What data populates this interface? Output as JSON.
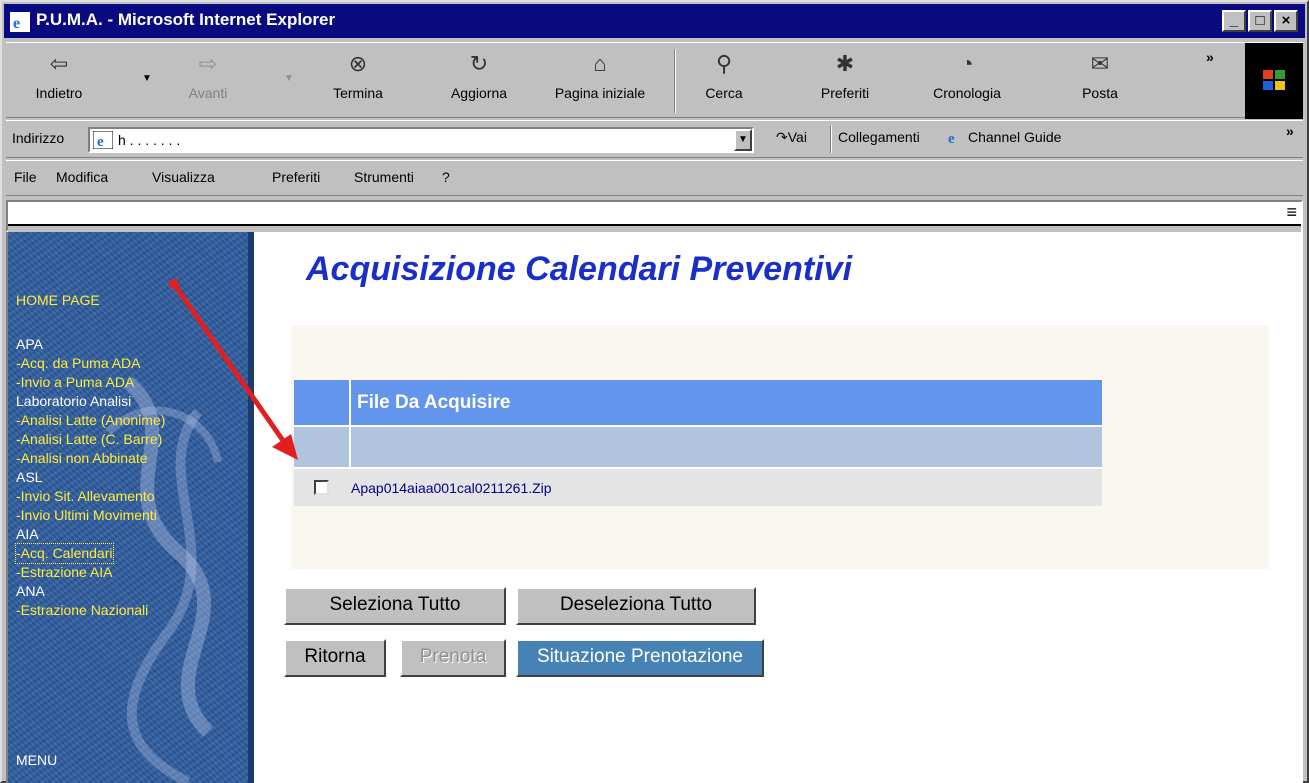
{
  "window": {
    "title": "P.U.M.A. - Microsoft Internet Explorer",
    "min": "_",
    "max": "□",
    "close": "×"
  },
  "toolbar": {
    "back": "Indietro",
    "forward": "Avanti",
    "stop": "Termina",
    "refresh": "Aggiorna",
    "home": "Pagina iniziale",
    "search": "Cerca",
    "favorites": "Preferiti",
    "history": "Cronologia",
    "mail": "Posta",
    "more": "»"
  },
  "addressbar": {
    "label": "Indirizzo",
    "value": "h   .  .  .  .  .  .  .",
    "go": "Vai",
    "links": "Collegamenti",
    "channel_guide": "Channel Guide",
    "more": "»"
  },
  "menu": {
    "file": "File",
    "edit": "Modifica",
    "view": "Visualizza",
    "favorites": "Preferiti",
    "tools": "Strumenti",
    "help": "?"
  },
  "sidebar": {
    "home": "HOME PAGE",
    "items": [
      {
        "label": "APA",
        "type": "head"
      },
      {
        "label": "-Acq. da Puma ADA",
        "type": "link"
      },
      {
        "label": "-Invio a Puma ADA",
        "type": "link"
      },
      {
        "label": "Laboratorio Analisi",
        "type": "head"
      },
      {
        "label": "-Analisi Latte (Anonime)",
        "type": "link"
      },
      {
        "label": "-Analisi Latte (C. Barre)",
        "type": "link"
      },
      {
        "label": "-Analisi non Abbinate",
        "type": "link"
      },
      {
        "label": "ASL",
        "type": "head"
      },
      {
        "label": "-Invio Sit. Allevamento",
        "type": "link"
      },
      {
        "label": "-Invio Ultimi Movimenti",
        "type": "link"
      },
      {
        "label": "AIA",
        "type": "head"
      },
      {
        "label": "-Acq. Calendari",
        "type": "link",
        "active": true
      },
      {
        "label": "-Estrazione AIA",
        "type": "link"
      },
      {
        "label": "ANA",
        "type": "head"
      },
      {
        "label": "-Estrazione Nazionali",
        "type": "link"
      }
    ],
    "menu": "MENU"
  },
  "main": {
    "title": "Acquisizione Calendari Preventivi",
    "table": {
      "header": "File Da Acquisire",
      "rows": [
        {
          "checked": false,
          "name": "Apap014aiaa001cal0211261.Zip"
        }
      ]
    },
    "buttons": {
      "select_all": "Seleziona Tutto",
      "deselect_all": "Deseleziona Tutto",
      "back": "Ritorna",
      "book": "Prenota",
      "status": "Situazione Prenotazione"
    }
  },
  "colors": {
    "title_bar": "#0a0a80",
    "sidebar": "#2f5ea0",
    "link": "#ffeb3b",
    "page_title": "#1a2ec8",
    "table_header": "#6495ed",
    "table_subheader": "#b0c4de",
    "annotation_arrow": "#e02020"
  }
}
